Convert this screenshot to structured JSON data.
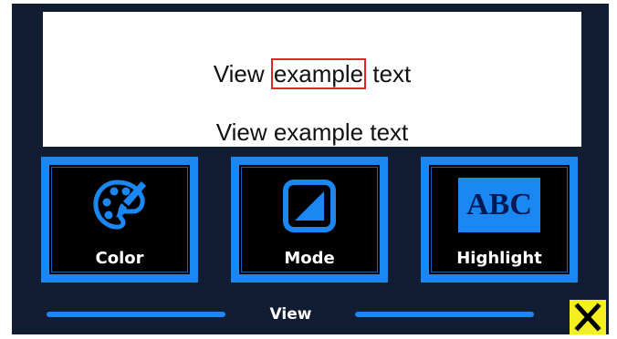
{
  "preview": {
    "line1_before": "View ",
    "line1_highlight": "example",
    "line1_after": " text",
    "line2": "View example text"
  },
  "tiles": [
    {
      "label": "Color",
      "icon": "palette-icon"
    },
    {
      "label": "Mode",
      "icon": "contrast-mode-icon"
    },
    {
      "label": "Highlight",
      "icon": "abc-highlight-icon",
      "icon_text": "ABC"
    }
  ],
  "footer": {
    "view_label": "View",
    "close_icon": "close-icon"
  },
  "colors": {
    "background": "#111d33",
    "accent": "#1a87f2",
    "tile_inner": "#000000",
    "highlight_border": "#e0262a",
    "close_button": "#f4f020"
  }
}
